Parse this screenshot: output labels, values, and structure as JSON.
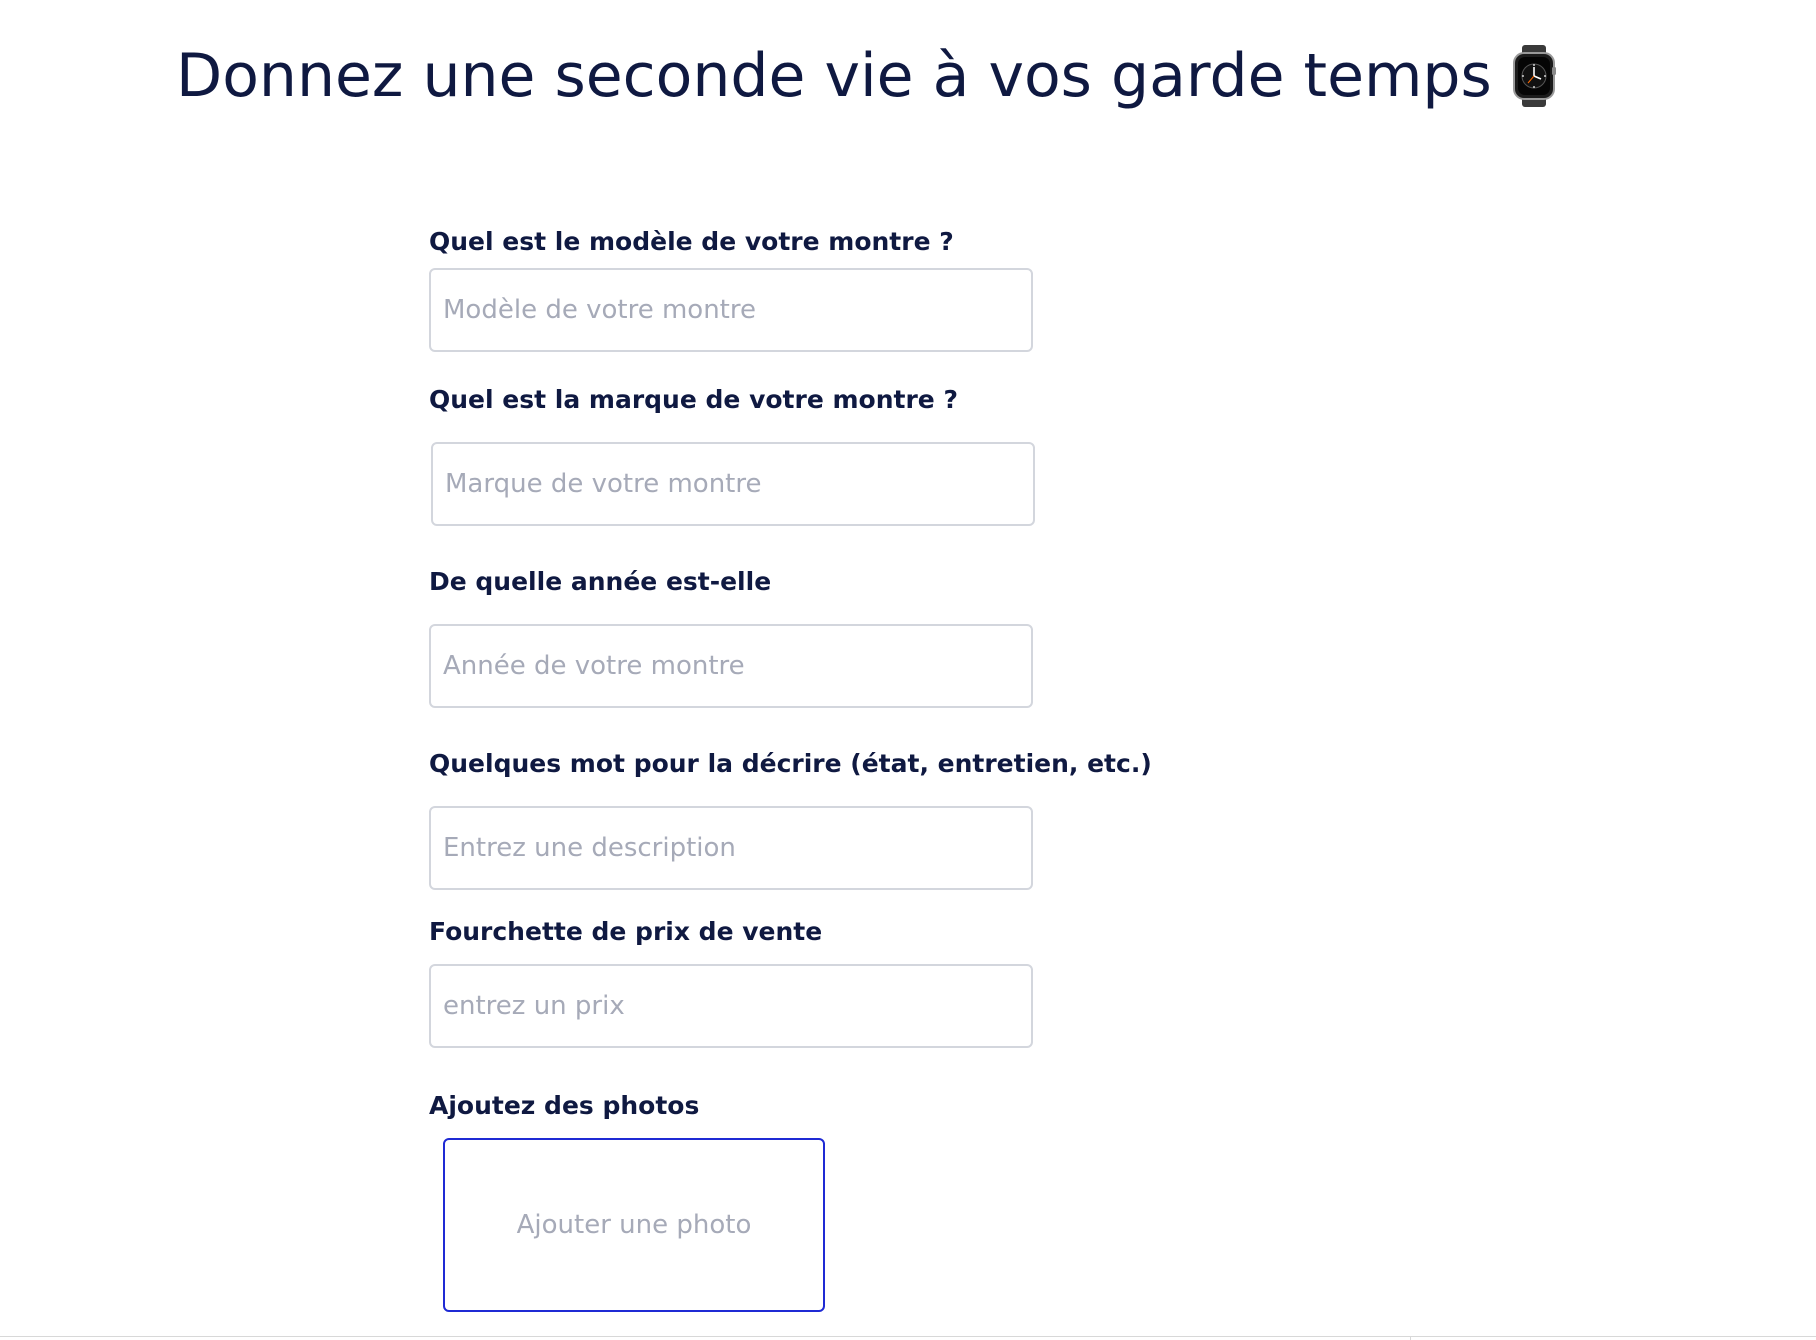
{
  "header": {
    "title": "Donnez une seconde vie à vos garde temps",
    "title_icon": "watch-icon"
  },
  "form": {
    "model": {
      "label": "Quel est le modèle de votre montre ?",
      "placeholder": "Modèle de votre montre",
      "value": ""
    },
    "brand": {
      "label": "Quel est la marque de votre montre ?",
      "placeholder": "Marque de votre montre",
      "value": ""
    },
    "year": {
      "label": "De quelle année est-elle",
      "placeholder": "Année de votre montre",
      "value": ""
    },
    "description": {
      "label": "Quelques mot pour la décrire (état, entretien,  etc.)",
      "placeholder": "Entrez une description",
      "value": ""
    },
    "price": {
      "label": "Fourchette de prix de vente",
      "placeholder": "entrez un prix",
      "value": ""
    },
    "photos": {
      "label": "Ajoutez des photos",
      "button_label": "Ajouter une photo"
    }
  },
  "colors": {
    "text": "#0f1941",
    "placeholder": "#a6aab8",
    "input_border": "#d3d6dd",
    "photo_border": "#1f2ad4"
  }
}
